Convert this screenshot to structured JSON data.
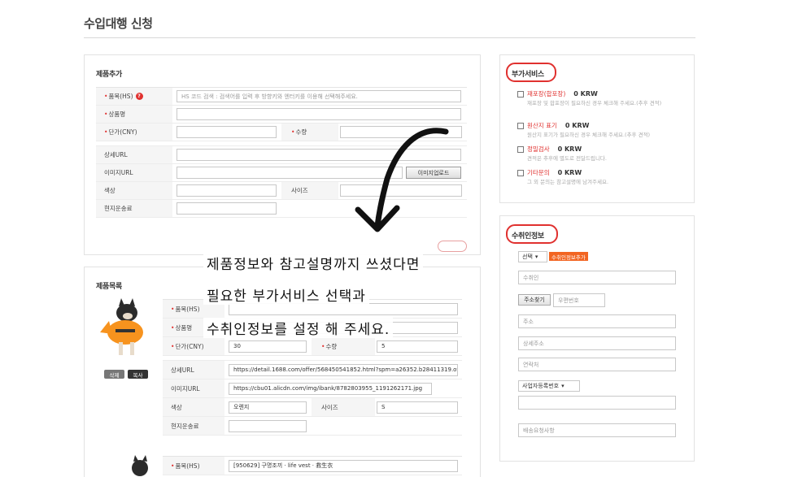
{
  "page": {
    "title": "수입대행 신청"
  },
  "product_add": {
    "heading": "제품추가",
    "hs_label": "품목(HS)",
    "help_glyph": "?",
    "hs_placeholder": "HS 코드 검색 : 검색어를 입력 후 방향키와 엔터키를 이용해 선택해주세요.",
    "name_label": "상품명",
    "price_label": "단가(CNY)",
    "qty_label": "수량",
    "url_label": "상세URL",
    "image_url_label": "이미지URL",
    "upload_button": "이미지업로드",
    "color_label": "색상",
    "size_label": "사이즈",
    "shipping_label": "현지운송료"
  },
  "product_list": {
    "heading": "제품목록",
    "delete_button": "삭제",
    "copy_button": "복사",
    "item": {
      "hs_label": "품목(HS)",
      "name_label": "상품명",
      "price_label": "단가(CNY)",
      "price_value": "30",
      "qty_label": "수량",
      "qty_value": "5",
      "url_label": "상세URL",
      "url_value": "https://detail.1688.com/offer/568450541852.html?spm=a26352.b28411319.offe",
      "image_url_label": "이미지URL",
      "image_url_value": "https://cbu01.alicdn.com/img/ibank/8782803955_1191262171.jpg",
      "color_label": "색상",
      "color_value": "오렌지",
      "size_label": "사이즈",
      "size_value": "S",
      "shipping_label": "현지운송료"
    },
    "item2": {
      "hs_label": "품목(HS)",
      "hs_value": "[950629] 구명조끼 · life vest · 救生衣"
    }
  },
  "extra_services": {
    "heading": "부가서비스",
    "items": [
      {
        "name": "재포장(합포장)",
        "price": "0 KRW",
        "desc": "재포장 및 합포장이 필요하신 경우 체크해 주세요.(추후 견적)"
      },
      {
        "name": "원산지 표기",
        "price": "0 KRW",
        "desc": "원산지 표기가 필요하신 경우 체크해 주세요.(추후 견적)"
      },
      {
        "name": "정밀검사",
        "price": "0 KRW",
        "desc": "견적은 추후에 별도로 전달드립니다."
      },
      {
        "name": "기타문의",
        "price": "0 KRW",
        "desc": "그 외 문의는 참고설명에 남겨주세요."
      }
    ]
  },
  "recipient": {
    "heading": "수취인정보",
    "select_value": "선택",
    "add_badge": "수취인정보추가",
    "name_placeholder": "수취인",
    "address_search_button": "주소찾기",
    "zip_placeholder": "우편번호",
    "address_placeholder": "주소",
    "address_detail_placeholder": "상세주소",
    "phone_placeholder": "연락처",
    "business_select": "사업자등록번호",
    "memo_placeholder": "배송요청사항"
  },
  "annotation": {
    "line1": "제품정보와 참고설명까지 쓰셨다면",
    "line2": "필요한 부가서비스 선택과",
    "line3": "수취인정보를 설정 해 주세요."
  },
  "colors": {
    "accent_red": "#e0312f",
    "badge_orange": "#f26522"
  }
}
